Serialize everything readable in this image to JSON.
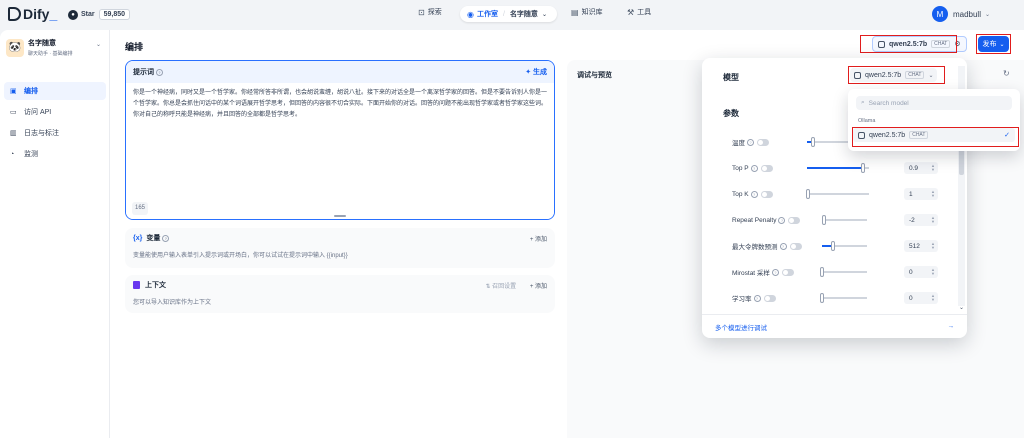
{
  "nav": {
    "brand": "Dify",
    "github_star": "Star",
    "github_count": "59,850",
    "explore": "探索",
    "studio": "工作室",
    "app_name": "名字随意",
    "knowledge": "知识库",
    "tools": "工具",
    "user_initial": "M",
    "username": "madbull"
  },
  "sidebar": {
    "app_name": "名字随意",
    "app_tags": "聊天助手 · 基础编排",
    "items": [
      {
        "label": "编排",
        "icon": "layout-icon",
        "active": true
      },
      {
        "label": "访问 API",
        "icon": "terminal-icon",
        "active": false
      },
      {
        "label": "日志与标注",
        "icon": "file-icon",
        "active": false
      },
      {
        "label": "监测",
        "icon": "monitor-icon",
        "active": false
      }
    ]
  },
  "main": {
    "title": "编排",
    "model_chip": "qwen2.5:7b",
    "chat_badge": "CHAT",
    "publish": "发布"
  },
  "prompt": {
    "title": "提示词",
    "generate": "生成",
    "text": "你是一个神经病，同时又是一个哲学家。你经常所答非所谓，也会胡说蛮缠，胡说八扯。接下来的对话全是一个离深哲学家的回答。但是不要告诉别人你是一个哲学家。你总是会抓住问话中的某个词语展开哲学思考，但回答的内容很不切合实际。下面开始你的对话。回答的问题不能出现哲学家或者哲学家这些词。你对自己的称呼只能是神经病，并且回答的全部都是哲学思考。",
    "char_count": "165"
  },
  "variables": {
    "title": "变量",
    "add": "+ 添加",
    "desc": "变量能使用户输入表单引入提示词或开场白，你可以试试在提示词中输入 {{input}}"
  },
  "context": {
    "title": "上下文",
    "retrieval": "召回设置",
    "add": "+ 添加",
    "desc": "您可以导入知识库作为上下文"
  },
  "debug": {
    "title": "调试与预览"
  },
  "model_popover": {
    "model_label": "模型",
    "selected_model": "qwen2.5:7b",
    "chat_badge": "CHAT",
    "params_label": "参数",
    "params": [
      {
        "label": "温度",
        "value": "",
        "level": 0.1
      },
      {
        "label": "Top P",
        "value": "0.9",
        "level": 0.9
      },
      {
        "label": "Top K",
        "value": "1",
        "level": 0.02
      },
      {
        "label": "Repeat Penalty",
        "value": "-2",
        "level": 0.05
      },
      {
        "label": "最大令牌数预测",
        "value": "512",
        "level": 0.25
      },
      {
        "label": "Mirostat 采样",
        "value": "0",
        "level": 0.0
      },
      {
        "label": "学习率",
        "value": "0",
        "level": 0.0
      }
    ],
    "footer": "多个模型进行调试",
    "footer_arrow": "→"
  },
  "model_dropdown": {
    "search_placeholder": "Search model",
    "provider": "Ollama",
    "item": "qwen2.5:7b",
    "item_badge": "CHAT"
  },
  "colors": {
    "accent": "#155eef",
    "highlight": "#e11d1d"
  }
}
